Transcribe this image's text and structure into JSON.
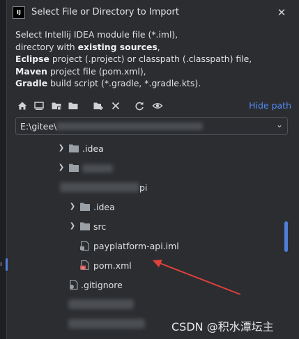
{
  "dialog": {
    "title": "Select File or Directory to Import",
    "app_icon_text": "IJ",
    "description": {
      "line1": "Select Intellij IDEA module file (*.iml),",
      "line2_pre": "directory with ",
      "line2_bold": "existing sources",
      "line2_post": ",",
      "line3_bold": "Eclipse",
      "line3_post": " project (.project) or classpath (.classpath) file,",
      "line4_bold": "Maven",
      "line4_post": " project file (pom.xml),",
      "line5_bold": "Gradle",
      "line5_post": " build script (*.gradle, *.gradle.kts)."
    },
    "hide_path_label": "Hide path",
    "path_value": "E:\\gitee\\"
  },
  "tree": {
    "items": [
      {
        "label": ".idea"
      },
      {
        "label": ""
      },
      {
        "label": "pi"
      },
      {
        "label": ".idea"
      },
      {
        "label": "src"
      },
      {
        "label": "payplatform-api.iml"
      },
      {
        "label": "pom.xml"
      },
      {
        "label": ".gitignore"
      }
    ]
  },
  "watermark": "CSDN @积水潭坛主",
  "colors": {
    "accent": "#548af7",
    "folder": "#9aa0a6",
    "maven_badge": "#c75450",
    "red_arrow": "#e0413b"
  },
  "icons": {
    "close": "close-icon",
    "home": "home-icon",
    "desktop": "desktop-icon",
    "project": "project-folder-icon",
    "module": "module-folder-icon",
    "new_folder": "new-folder-icon",
    "delete": "delete-icon",
    "refresh": "refresh-icon",
    "show_hidden": "show-hidden-icon",
    "dropdown": "chevron-down-icon"
  }
}
